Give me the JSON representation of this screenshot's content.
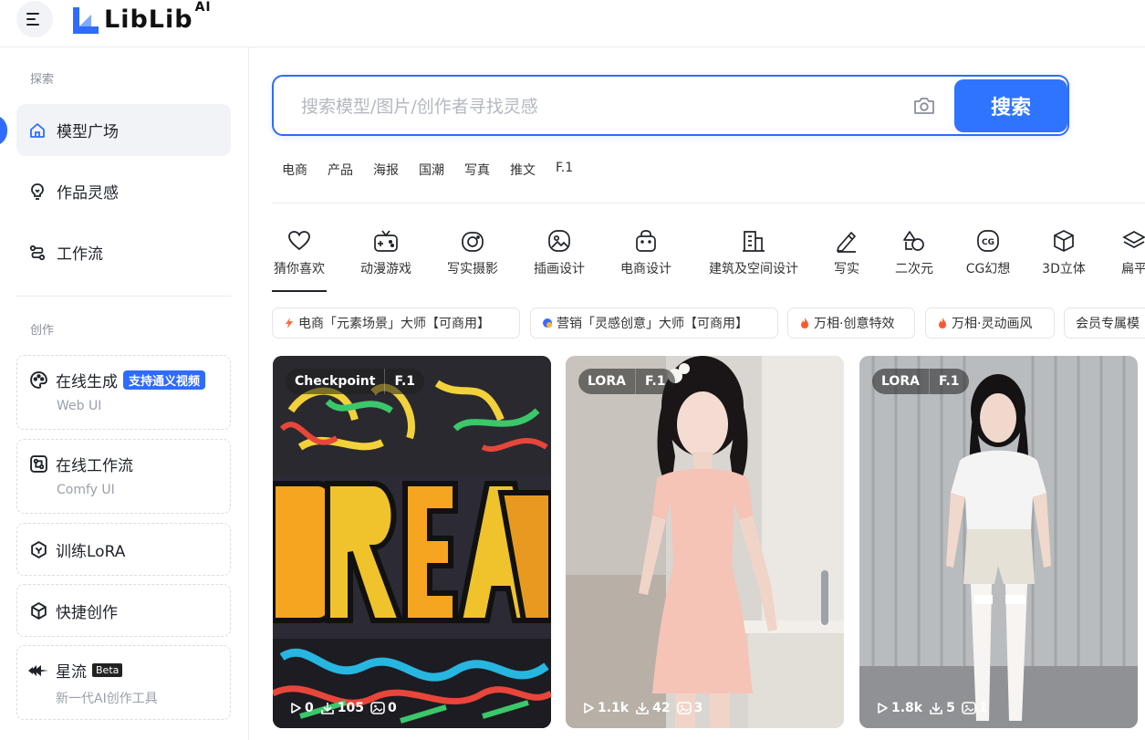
{
  "header": {
    "logo_text": "LibLib",
    "logo_suffix": "AI"
  },
  "sidebar": {
    "section_explore": "探索",
    "nav": [
      {
        "label": "模型广场"
      },
      {
        "label": "作品灵感"
      },
      {
        "label": "工作流"
      }
    ],
    "section_create": "创作",
    "cards": [
      {
        "title": "在线生成",
        "badge": "支持通义视频",
        "sub": "Web UI"
      },
      {
        "title": "在线工作流",
        "sub": "Comfy UI"
      },
      {
        "title": "训练LoRA"
      },
      {
        "title": "快捷创作"
      },
      {
        "title": "星流",
        "badge": "Beta",
        "sub": "新一代AI创作工具"
      }
    ]
  },
  "search": {
    "placeholder": "搜索模型/图片/创作者寻找灵感",
    "button": "搜索"
  },
  "hot_tags": [
    "电商",
    "产品",
    "海报",
    "国潮",
    "写真",
    "推文",
    "F.1"
  ],
  "categories": [
    "猜你喜欢",
    "动漫游戏",
    "写实摄影",
    "插画设计",
    "电商设计",
    "建筑及空间设计",
    "写实",
    "二次元",
    "CG幻想",
    "3D立体",
    "扁平"
  ],
  "chips": [
    "电商「元素场景」大师【可商用】",
    "营销「灵感创意」大师【可商用】",
    "万相·创意特效",
    "万相·灵动画风",
    "会员专属模"
  ],
  "tiles": [
    {
      "type": "Checkpoint",
      "base": "F.1",
      "runs": "0",
      "downloads": "105",
      "images": "0"
    },
    {
      "type": "LORA",
      "base": "F.1",
      "runs": "1.1k",
      "downloads": "42",
      "images": "3"
    },
    {
      "type": "LORA",
      "base": "F.1",
      "runs": "1.8k",
      "downloads": "5",
      "images": "1"
    }
  ],
  "colors": {
    "accent": "#2f6bff",
    "search_button": "#2f74ff"
  }
}
